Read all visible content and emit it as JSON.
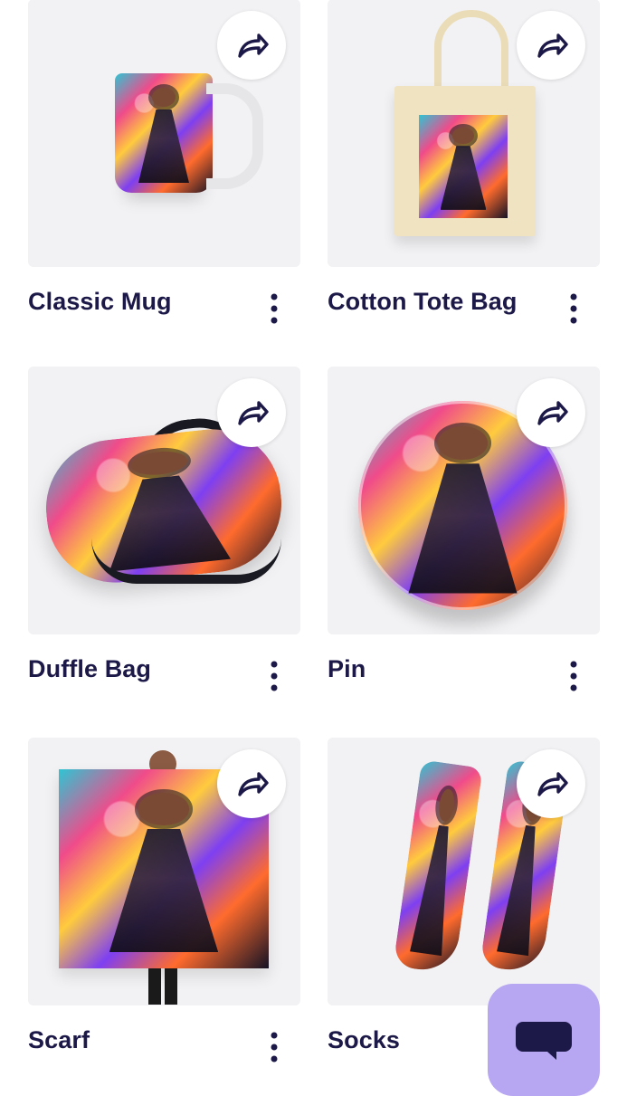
{
  "products": [
    {
      "title": "Classic Mug"
    },
    {
      "title": "Cotton Tote Bag"
    },
    {
      "title": "Duffle Bag"
    },
    {
      "title": "Pin"
    },
    {
      "title": "Scarf"
    },
    {
      "title": "Socks"
    }
  ],
  "icons": {
    "share": "share-icon",
    "more": "more-icon",
    "chat": "chat-icon"
  },
  "colors": {
    "title": "#1c1847",
    "icon": "#1c1847",
    "fab": "#b7a6f2",
    "card_background": "#f2f2f4"
  }
}
